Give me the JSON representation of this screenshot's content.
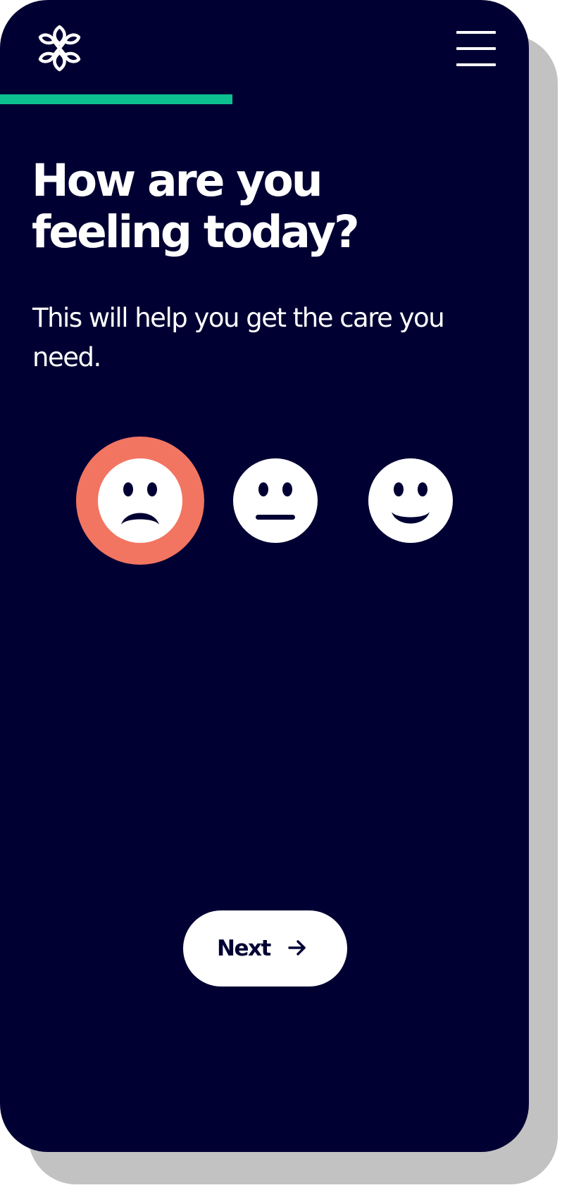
{
  "colors": {
    "background": "#010033",
    "accent_progress": "#0cc08f",
    "selected_ring": "#f27561",
    "foreground": "#ffffff"
  },
  "header": {
    "logo_icon": "lotus-logo-icon",
    "menu_icon": "hamburger-menu-icon"
  },
  "progress": {
    "fraction": 0.44
  },
  "main": {
    "title_line1": "How are you",
    "title_line2": "feeling today?",
    "subtitle": "This will help you get the care you need."
  },
  "moods": {
    "selected": "sad",
    "options": [
      {
        "id": "sad",
        "icon": "sad-face-icon"
      },
      {
        "id": "neutral",
        "icon": "neutral-face-icon"
      },
      {
        "id": "happy",
        "icon": "happy-face-icon"
      }
    ]
  },
  "footer": {
    "next_label": "Next",
    "next_icon": "arrow-right-icon"
  }
}
